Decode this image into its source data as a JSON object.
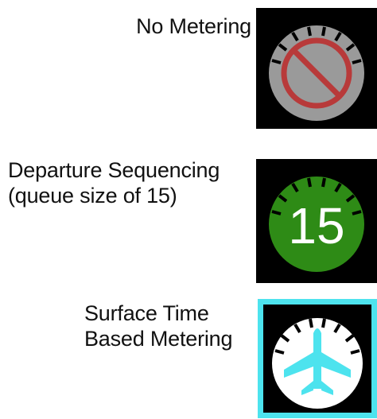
{
  "modes": [
    {
      "id": "no-metering",
      "label_lines": [
        "No Metering"
      ],
      "icon": "prohibited-icon",
      "dial_color": "#9a9a9a",
      "symbol_color": "#b83a3a",
      "tick_color": "#000000",
      "highlighted": false
    },
    {
      "id": "departure-sequencing",
      "label_lines": [
        "Departure Sequencing",
        "(queue size of 15)"
      ],
      "icon": "queue-count-dial",
      "dial_color": "#2e8b16",
      "value": "15",
      "value_color": "#ffffff",
      "tick_color": "#000000",
      "highlighted": false
    },
    {
      "id": "surface-time-based-metering",
      "label_lines": [
        "Surface Time",
        "Based Metering"
      ],
      "icon": "airplane-icon",
      "dial_color": "#ffffff",
      "symbol_color": "#4de3ee",
      "tick_color": "#000000",
      "highlighted": true,
      "highlight_color": "#4de3ee"
    }
  ]
}
